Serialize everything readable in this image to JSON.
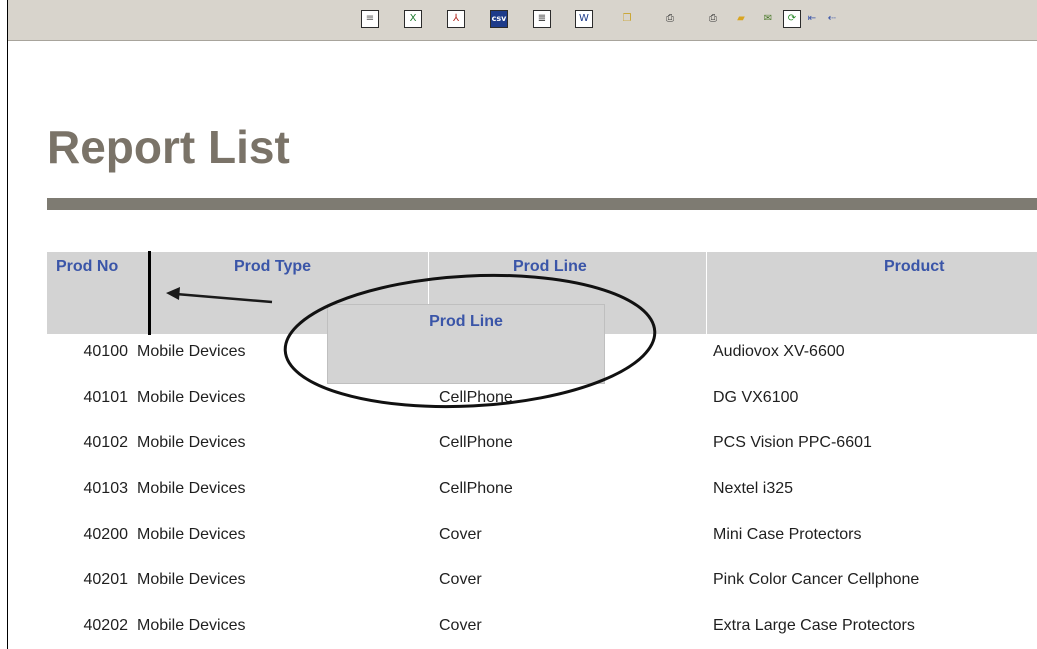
{
  "page": {
    "title": "Report List"
  },
  "toolbar": {
    "icons": [
      {
        "name": "table-view-icon",
        "glyph": "≡",
        "color": "#555555"
      },
      {
        "name": "excel-export-icon",
        "glyph": "X",
        "color": "#1d7a2e"
      },
      {
        "name": "pdf-export-icon",
        "glyph": "⅄",
        "color": "#b3261e"
      },
      {
        "name": "csv-export-icon",
        "glyph": "csv",
        "color": "#1d3b8a"
      },
      {
        "name": "text-export-icon",
        "glyph": "≣",
        "color": "#333333"
      },
      {
        "name": "word-export-icon",
        "glyph": "W",
        "color": "#1d3b8a"
      },
      {
        "name": "copy-icon",
        "glyph": "❐",
        "color": "#c9a227"
      },
      {
        "name": "print-icon",
        "glyph": "⎙",
        "color": "#333333"
      },
      {
        "name": "print-preview-icon",
        "glyph": "⎙",
        "color": "#333333"
      },
      {
        "name": "open-folder-icon",
        "glyph": "▰",
        "color": "#d9a521"
      },
      {
        "name": "email-icon",
        "glyph": "✉",
        "color": "#4a7a2a"
      },
      {
        "name": "refresh-icon",
        "glyph": "⟳",
        "color": "#2a8a2a"
      },
      {
        "name": "first-page-icon",
        "glyph": "⇤",
        "color": "#3a55a8"
      },
      {
        "name": "previous-page-icon",
        "glyph": "⇠",
        "color": "#3a55a8"
      }
    ]
  },
  "table": {
    "columns": [
      "Prod No",
      "Prod Type",
      "Prod Line",
      "Product"
    ],
    "drag_ghost_label": "Prod Line",
    "rows": [
      {
        "prod_no": "40100",
        "prod_type": "Mobile Devices",
        "prod_line": "",
        "product": "Audiovox XV-6600"
      },
      {
        "prod_no": "40101",
        "prod_type": "Mobile Devices",
        "prod_line": "CellPhone",
        "product": "DG VX6100"
      },
      {
        "prod_no": "40102",
        "prod_type": "Mobile Devices",
        "prod_line": "CellPhone",
        "product": "PCS Vision PPC-6601"
      },
      {
        "prod_no": "40103",
        "prod_type": "Mobile Devices",
        "prod_line": "CellPhone",
        "product": "Nextel i325"
      },
      {
        "prod_no": "40200",
        "prod_type": "Mobile Devices",
        "prod_line": "Cover",
        "product": "Mini Case Protectors"
      },
      {
        "prod_no": "40201",
        "prod_type": "Mobile Devices",
        "prod_line": "Cover",
        "product": "Pink Color Cancer Cellphone"
      },
      {
        "prod_no": "40202",
        "prod_type": "Mobile Devices",
        "prod_line": "Cover",
        "product": "Extra Large Case Protectors"
      }
    ]
  },
  "colors": {
    "header_text": "#3a55a8",
    "header_bg": "#d3d3d3",
    "title": "#7a7368",
    "rule": "#7e7b72",
    "toolbar_bg": "#d8d4cc"
  }
}
